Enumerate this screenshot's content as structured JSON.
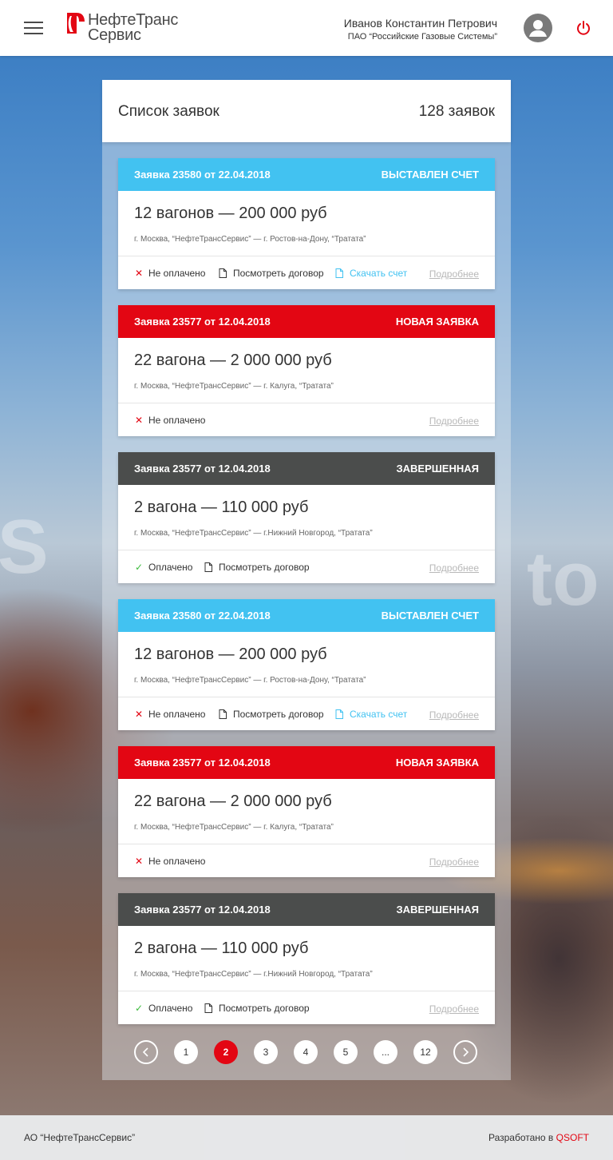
{
  "header": {
    "logo_line1": "НефтеТранс",
    "logo_line2": "Сервис",
    "user_name": "Иванов Константин Петрович",
    "user_org": "ПАО “Российские Газовые Системы”"
  },
  "panel": {
    "title": "Список заявок",
    "count": "128 заявок"
  },
  "orders": [
    {
      "head": "Заявка 23580 от 22.04.2018",
      "status": "ВЫСТАВЛЕН СЧЕТ",
      "status_color": "#42c2f1",
      "sum": "12 вагонов — 200 000 руб",
      "route": "г. Москва, “НефтеТрансСервис” — г. Ростов-на-Дону, “Тратата”",
      "payment": "Не оплачено",
      "contract": "Посмотреть договор",
      "invoice": "Скачать счет",
      "more": "Подробнее"
    },
    {
      "head": "Заявка 23577 от 12.04.2018",
      "status": "НОВАЯ ЗАЯВКА",
      "status_color": "#e30613",
      "sum": "22 вагона — 2 000 000 руб",
      "route": "г. Москва, “НефтеТрансСервис” — г. Калуга, “Тратата”",
      "payment": "Не оплачено",
      "more": "Подробнее"
    },
    {
      "head": "Заявка 23577 от 12.04.2018",
      "status": "ЗАВЕРШЕННАЯ",
      "status_color": "#4b4d4c",
      "sum": "2 вагона — 110 000 руб",
      "route": "г. Москва, “НефтеТрансСервис” — г.Нижний Новгород, “Тратата”",
      "payment": "Оплачено",
      "contract": "Посмотреть договор",
      "more": "Подробнее"
    },
    {
      "head": "Заявка 23580 от 22.04.2018",
      "status": "ВЫСТАВЛЕН СЧЕТ",
      "status_color": "#42c2f1",
      "sum": "12 вагонов — 200 000 руб",
      "route": "г. Москва, “НефтеТрансСервис” — г. Ростов-на-Дону, “Тратата”",
      "payment": "Не оплачено",
      "contract": "Посмотреть договор",
      "invoice": "Скачать счет",
      "more": "Подробнее"
    },
    {
      "head": "Заявка 23577 от 12.04.2018",
      "status": "НОВАЯ ЗАЯВКА",
      "status_color": "#e30613",
      "sum": "22 вагона — 2 000 000 руб",
      "route": "г. Москва, “НефтеТрансСервис” — г. Калуга, “Тратата”",
      "payment": "Не оплачено",
      "more": "Подробнее"
    },
    {
      "head": "Заявка 23577 от 12.04.2018",
      "status": "ЗАВЕРШЕННАЯ",
      "status_color": "#4b4d4c",
      "sum": "2 вагона — 110 000 руб",
      "route": "г. Москва, “НефтеТрансСервис” — г.Нижний Новгород, “Тратата”",
      "payment": "Оплачено",
      "contract": "Посмотреть договор",
      "more": "Подробнее"
    }
  ],
  "pagination": {
    "pages": [
      "1",
      "2",
      "3",
      "4",
      "5",
      "...",
      "12"
    ],
    "current": "2",
    "prev_icon": "chevron-left-icon",
    "next_icon": "chevron-right-icon"
  },
  "footer": {
    "company": "АО “НефтеТрансСервис”",
    "dev_prefix": "Разработано в",
    "dev_brand": "QSOFT"
  },
  "icons": {
    "menu": "hamburger-icon",
    "user": "user-avatar-icon",
    "logout": "power-icon",
    "unpaid": "cross-icon",
    "paid": "check-icon",
    "document": "document-icon"
  },
  "colors": {
    "accent_red": "#e30613",
    "accent_blue": "#42c2f1",
    "dark_status": "#4b4d4c"
  }
}
